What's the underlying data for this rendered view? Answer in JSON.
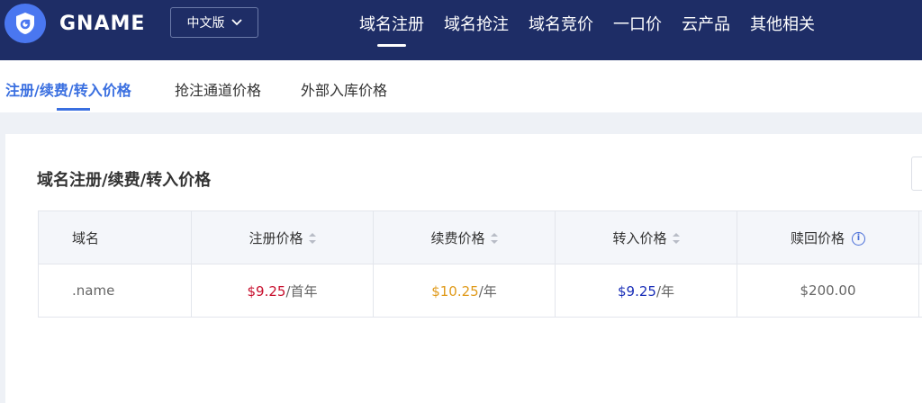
{
  "header": {
    "brand": "GNAME",
    "lang_label": "中文版",
    "nav": [
      {
        "label": "域名注册",
        "active": true
      },
      {
        "label": "域名抢注",
        "active": false
      },
      {
        "label": "域名竞价",
        "active": false
      },
      {
        "label": "一口价",
        "active": false
      },
      {
        "label": "云产品",
        "active": false
      },
      {
        "label": "其他相关",
        "active": false
      }
    ]
  },
  "subtabs": [
    {
      "label": "注册/续费/转入价格",
      "active": true
    },
    {
      "label": "抢注通道价格",
      "active": false
    },
    {
      "label": "外部入库价格",
      "active": false
    }
  ],
  "card": {
    "title": "域名注册/续费/转入价格"
  },
  "table": {
    "headers": [
      "域名",
      "注册价格",
      "续费价格",
      "转入价格",
      "赎回价格"
    ],
    "rows": [
      {
        "domain": ".name",
        "register_price": "$9.25",
        "register_unit": "/首年",
        "renew_price": "$10.25",
        "renew_unit": "/年",
        "transfer_price": "$9.25",
        "transfer_unit": "/年",
        "redeem_price": "$200.00"
      }
    ]
  },
  "colors": {
    "nav_bg": "#1e2d66",
    "accent": "#3a6fe0",
    "register_price": "#c8102e",
    "renew_price": "#e09a1a",
    "transfer_price": "#1a2fb8"
  },
  "icons": [
    "gname-logo-icon",
    "chevron-down-icon",
    "sort-icon",
    "info-icon"
  ]
}
